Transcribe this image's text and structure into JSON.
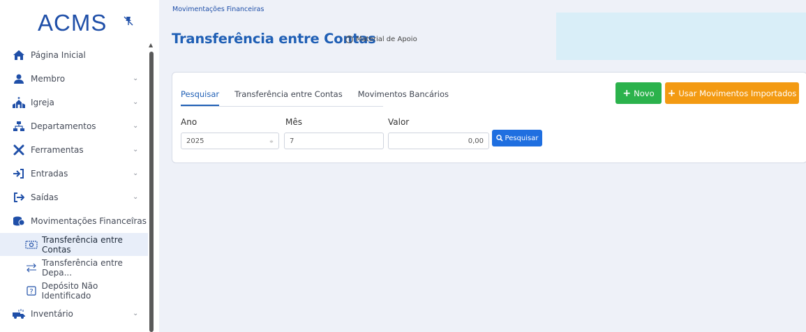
{
  "app": {
    "logo": "ACMS"
  },
  "sidebar": {
    "items": [
      {
        "label": "Página Inicial",
        "icon": "home-icon",
        "chevron": ""
      },
      {
        "label": "Membro",
        "icon": "person-icon",
        "chevron": "⌄"
      },
      {
        "label": "Igreja",
        "icon": "church-icon",
        "chevron": "⌄"
      },
      {
        "label": "Departamentos",
        "icon": "sitemap-icon",
        "chevron": "⌄"
      },
      {
        "label": "Ferramentas",
        "icon": "tools-icon",
        "chevron": "⌄"
      },
      {
        "label": "Entradas",
        "icon": "sign-in-icon",
        "chevron": "⌄"
      },
      {
        "label": "Saídas",
        "icon": "sign-out-icon",
        "chevron": "⌄"
      },
      {
        "label": "Movimentações Financeiras",
        "icon": "coins-icon",
        "chevron": "^"
      }
    ],
    "subitems": [
      {
        "label": "Transferência entre Contas",
        "icon": "money-icon"
      },
      {
        "label": "Transferência entre Depa...",
        "icon": "transfer-icon"
      },
      {
        "label": "Depósito Não Identificado",
        "icon": "question-box-icon"
      }
    ],
    "last_item": {
      "label": "Inventário",
      "icon": "truck-icon",
      "chevron": "⌄"
    }
  },
  "main": {
    "breadcrumb": "Movimentações Financeiras",
    "title": "Transferência entre Contas",
    "help_link": "Material de Apoio",
    "tabs": [
      "Pesquisar",
      "Transferência entre Contas",
      "Movimentos Bancários"
    ],
    "buttons": {
      "new": "Novo",
      "import": "Usar Movimentos Importados",
      "search": "Pesquisar"
    },
    "form": {
      "ano_label": "Ano",
      "ano_value": "2025",
      "mes_label": "Mês",
      "mes_value": "7",
      "valor_label": "Valor",
      "valor_value": "0,00"
    }
  },
  "colors": {
    "primary": "#1f5fb5",
    "success": "#2bb24c",
    "warning": "#f39a12",
    "search": "#1f6fe0",
    "banner": "#d9eef8"
  }
}
